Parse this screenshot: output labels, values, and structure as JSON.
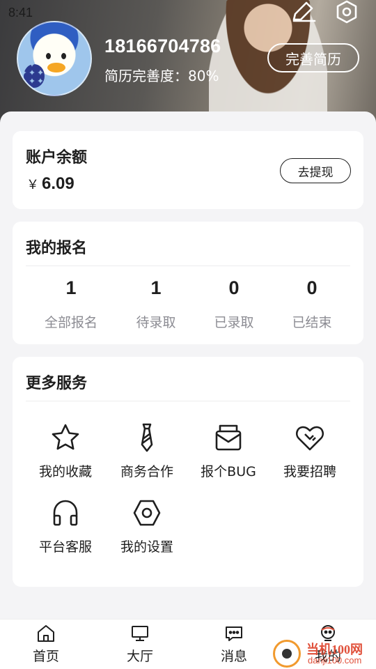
{
  "status_bar": {
    "time": "8:41"
  },
  "profile": {
    "phone": "18166704786",
    "completeness": "简历完善度：80%",
    "resume_button": "完善简历",
    "edit_icon": "edit-icon",
    "settings_icon": "hex-settings-icon"
  },
  "balance": {
    "title": "账户余额",
    "currency": "￥",
    "amount": "6.09",
    "withdraw_button": "去提现"
  },
  "signups": {
    "title": "我的报名",
    "stats": [
      {
        "count": "1",
        "label": "全部报名"
      },
      {
        "count": "1",
        "label": "待录取"
      },
      {
        "count": "0",
        "label": "已录取"
      },
      {
        "count": "0",
        "label": "已结束"
      }
    ]
  },
  "services": {
    "title": "更多服务",
    "items": [
      {
        "label": "我的收藏",
        "icon": "star-icon"
      },
      {
        "label": "商务合作",
        "icon": "tie-icon"
      },
      {
        "label": "报个BUG",
        "icon": "mail-box-icon"
      },
      {
        "label": "我要招聘",
        "icon": "handshake-heart-icon"
      },
      {
        "label": "平台客服",
        "icon": "headset-icon"
      },
      {
        "label": "我的设置",
        "icon": "hex-nut-icon"
      }
    ]
  },
  "tabbar": {
    "items": [
      {
        "label": "首页",
        "icon": "home-icon"
      },
      {
        "label": "大厅",
        "icon": "monitor-icon"
      },
      {
        "label": "消息",
        "icon": "message-icon"
      },
      {
        "label": "我的",
        "icon": "profile-icon"
      }
    ]
  },
  "watermark": {
    "name": "当机100网",
    "url": "danji100.com"
  }
}
